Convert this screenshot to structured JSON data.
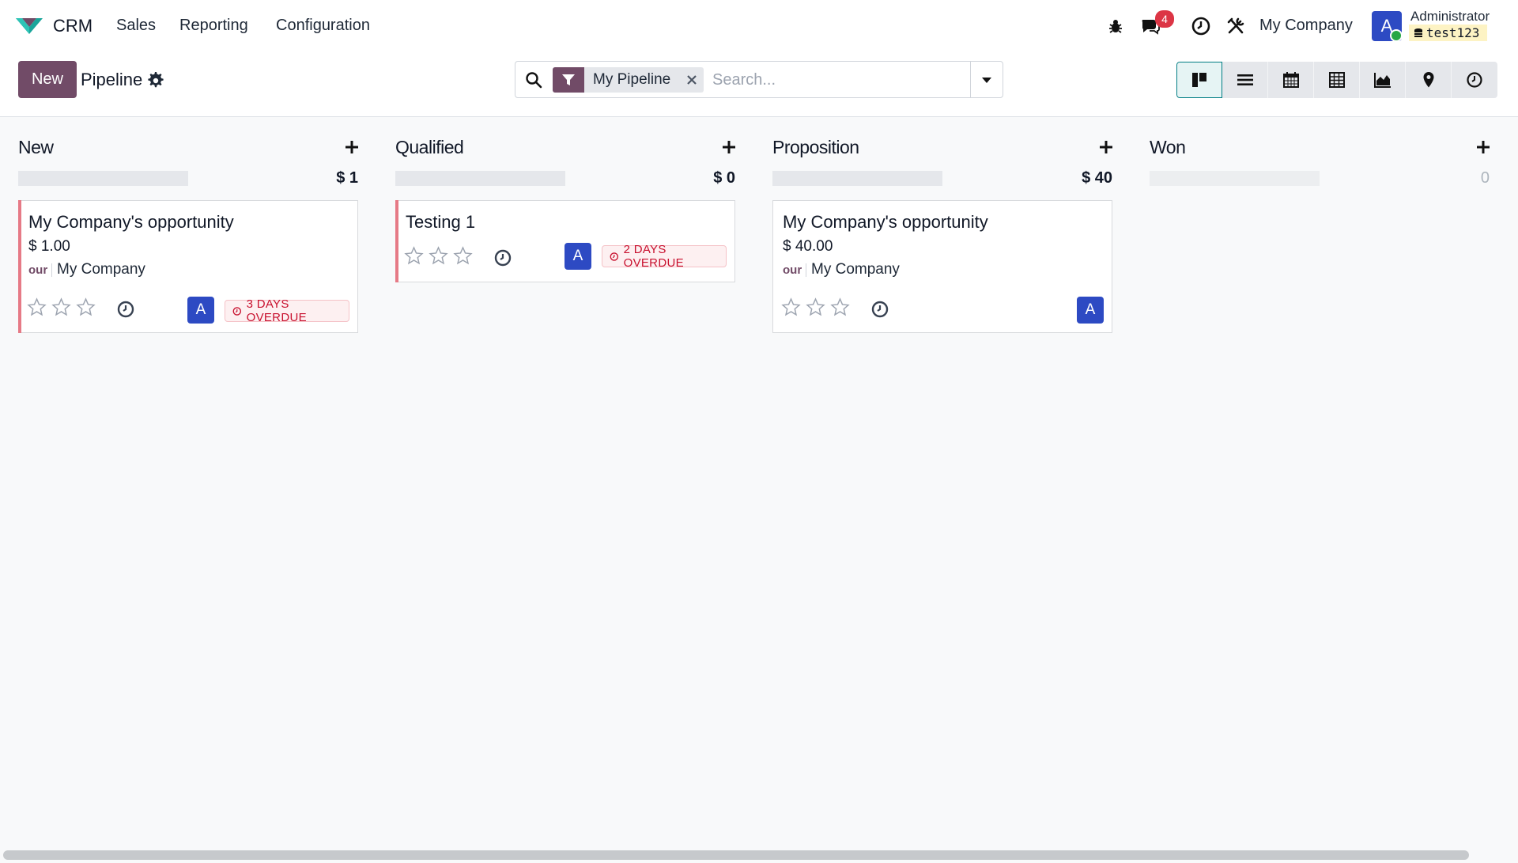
{
  "app": {
    "name": "CRM",
    "logo_icon": "crm-logo-icon"
  },
  "menu": {
    "items": [
      {
        "label": "Sales"
      },
      {
        "label": "Reporting"
      },
      {
        "label": "Configuration"
      }
    ]
  },
  "systray": {
    "debug_icon": "bug-icon",
    "messages_icon": "chat-icon",
    "messages_count": "4",
    "activity_icon": "clock-icon",
    "tools_icon": "tools-icon",
    "company": "My Company",
    "user": {
      "avatar_letter": "A",
      "name": "Administrator",
      "database": "test123"
    }
  },
  "control_panel": {
    "new_label": "New",
    "title": "Pipeline",
    "search": {
      "facet_label": "My Pipeline",
      "placeholder": "Search..."
    },
    "views": [
      "kanban",
      "list",
      "calendar",
      "pivot",
      "graph",
      "map",
      "activity"
    ]
  },
  "colors": {
    "primary": "#714b67",
    "avatar": "#2d4ac3",
    "danger": "#c8102e",
    "ribbon": "#e67a86"
  },
  "stages": [
    {
      "name": "New",
      "total": "$ 1",
      "cards": [
        {
          "title": "My Company's opportunity",
          "amount": "$ 1.00",
          "partner_logo": "our",
          "partner": "My Company",
          "avatar": "A",
          "overdue": "3 DAYS OVERDUE",
          "stars": 0
        }
      ]
    },
    {
      "name": "Qualified",
      "total": "$ 0",
      "cards": [
        {
          "title": "Testing 1",
          "avatar": "A",
          "overdue": "2 DAYS OVERDUE",
          "stars": 0
        }
      ]
    },
    {
      "name": "Proposition",
      "total": "$ 40",
      "cards": [
        {
          "title": "My Company's opportunity",
          "amount": "$ 40.00",
          "partner_logo": "our",
          "partner": "My Company",
          "avatar": "A",
          "stars": 0
        }
      ]
    },
    {
      "name": "Won",
      "total": "0",
      "cards": []
    }
  ]
}
